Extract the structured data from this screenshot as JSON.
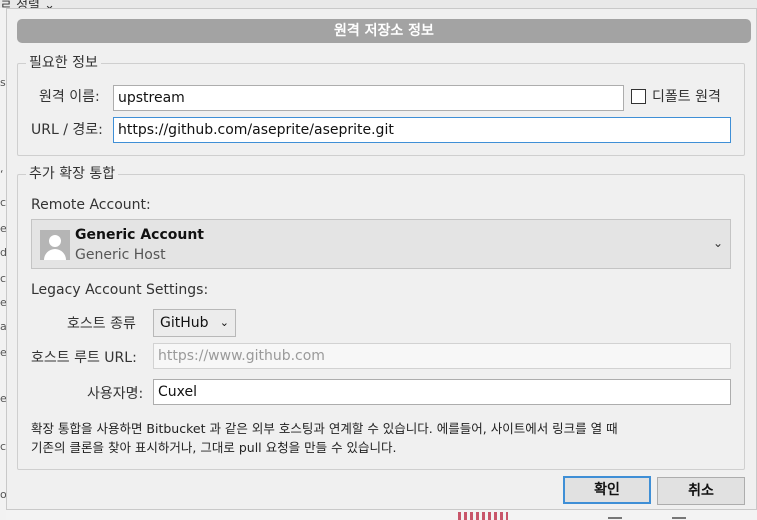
{
  "background": {
    "top_text": "ㄹ 정렬 ⌄",
    "left_letters": [
      "s",
      "‘",
      "c",
      "e",
      "d",
      "c",
      "e",
      "a",
      "e",
      "e",
      "c",
      "o"
    ]
  },
  "dialog": {
    "title": "원격 저장소 정보",
    "required_group": {
      "legend": "필요한 정보",
      "remote_name_label": "원격 이름:",
      "remote_name_value": "upstream",
      "default_remote_label": "디폴트 원격",
      "default_remote_checked": false,
      "url_label": "URL / 경로:",
      "url_value": "https://github.com/aseprite/aseprite.git"
    },
    "integration_group": {
      "legend": "추가 확장 통합",
      "remote_account_label": "Remote Account:",
      "account": {
        "name": "Generic Account",
        "host": "Generic Host"
      },
      "legacy_label": "Legacy Account Settings:",
      "host_type_label": "호스트 종류",
      "host_type_value": "GitHub",
      "host_root_label": "호스트 루트 URL:",
      "host_root_placeholder": "https://www.github.com",
      "username_label": "사용자명:",
      "username_value": "Cuxel",
      "help_line1": "확장 통합을 사용하면 Bitbucket 과 같은 외부 호스팅과 연계할 수 있습니다. 에를들어, 사이트에서 링크를 열 때",
      "help_line2": "기존의 클론을 찾아 표시하거나, 그대로 pull 요청을 만들 수 있습니다."
    },
    "ok_button": "확인",
    "cancel_button": "취소"
  },
  "colors": {
    "title_bar": "#a3a3a3",
    "focus_accent": "#3f8fd6",
    "dialog_bg": "#f0f0f0"
  }
}
